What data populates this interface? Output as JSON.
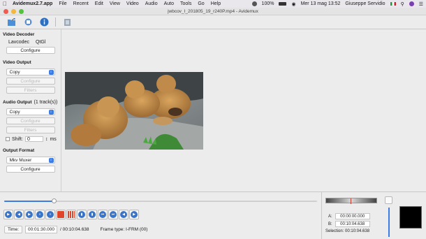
{
  "menubar": {
    "app_name": "Avidemux2.7.app",
    "items": [
      "File",
      "Recent",
      "Edit",
      "View",
      "Video",
      "Audio",
      "Auto",
      "Tools",
      "Go",
      "Help"
    ],
    "battery": "100%",
    "datetime": "Mer 13 mag  13:52",
    "user": "Giuseppe Servidio"
  },
  "window": {
    "title": "jwbcov_I_201805_19_r240P.mp4 - Avidemux"
  },
  "toolbar": {
    "icons": [
      "open-file-icon",
      "save-icon",
      "info-icon",
      "script-icon"
    ]
  },
  "video_decoder": {
    "heading": "Video Decoder",
    "codec": "Lavcodec",
    "extra": "QtGl",
    "configure": "Configure"
  },
  "video_output": {
    "heading": "Video Output",
    "selected": "Copy",
    "configure": "Configure",
    "filters": "Filters"
  },
  "audio_output": {
    "heading": "Audio Output",
    "tracks": "(1 track(s))",
    "selected": "Copy",
    "configure": "Configure",
    "filters": "Filters",
    "shift_label": "Shift:",
    "shift_value": "0",
    "shift_unit": "ms"
  },
  "output_format": {
    "heading": "Output Format",
    "selected": "Mkv Muxer",
    "configure": "Configure"
  },
  "timeline": {
    "position_fraction": 0.16
  },
  "status": {
    "time_label": "Time:",
    "current_time": "00:01:30.000",
    "total_time": "/ 00:10:04.638",
    "frame_type": "Frame type:  I-FRM (00)"
  },
  "selection": {
    "a_label": "A:",
    "a_value": "00:00:00.000",
    "b_label": "B:",
    "b_value": "00:10:04.638",
    "selection_text": "Selection: 00:10:04.638"
  },
  "colors": {
    "accent": "#3b7de5",
    "button_blue": "#3a74c8",
    "record_red": "#e0452a"
  }
}
